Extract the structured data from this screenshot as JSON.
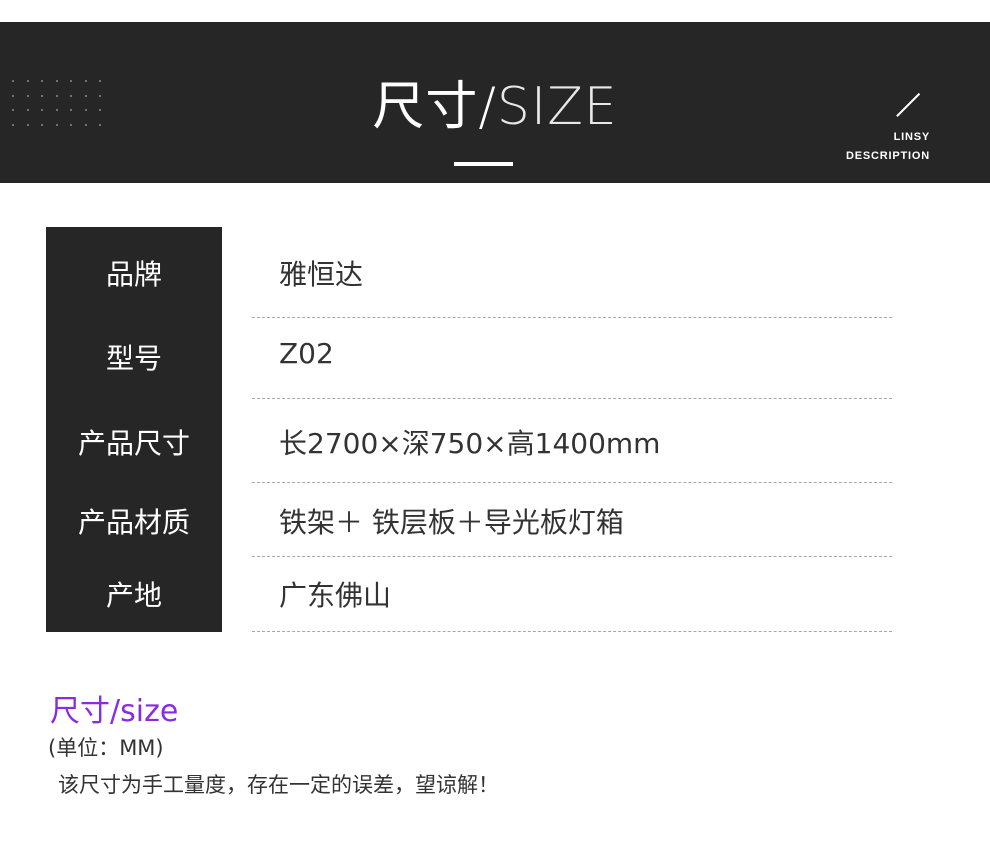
{
  "header": {
    "title_cn": "尺寸/",
    "title_en": "SIZE",
    "brand_line1": "LINSY",
    "brand_line2": "DESCRIPTION"
  },
  "specs": [
    {
      "label": "品牌",
      "value": "雅恒达"
    },
    {
      "label": "型号",
      "value": "Z02"
    },
    {
      "label": "产品尺寸",
      "value": "长2700×深750×高1400mm"
    },
    {
      "label": "产品材质",
      "value": "铁架＋ 铁层板＋导光板灯箱"
    },
    {
      "label": "产地",
      "value": "广东佛山"
    }
  ],
  "notes": {
    "title": "尺寸/size",
    "unit": "(单位：MM)",
    "description": "该尺寸为手工量度，存在一定的误差，望谅解！"
  },
  "colors": {
    "banner_bg": "#262626",
    "label_bg": "#262626",
    "accent_purple": "#8a2be2",
    "text": "#333333"
  }
}
